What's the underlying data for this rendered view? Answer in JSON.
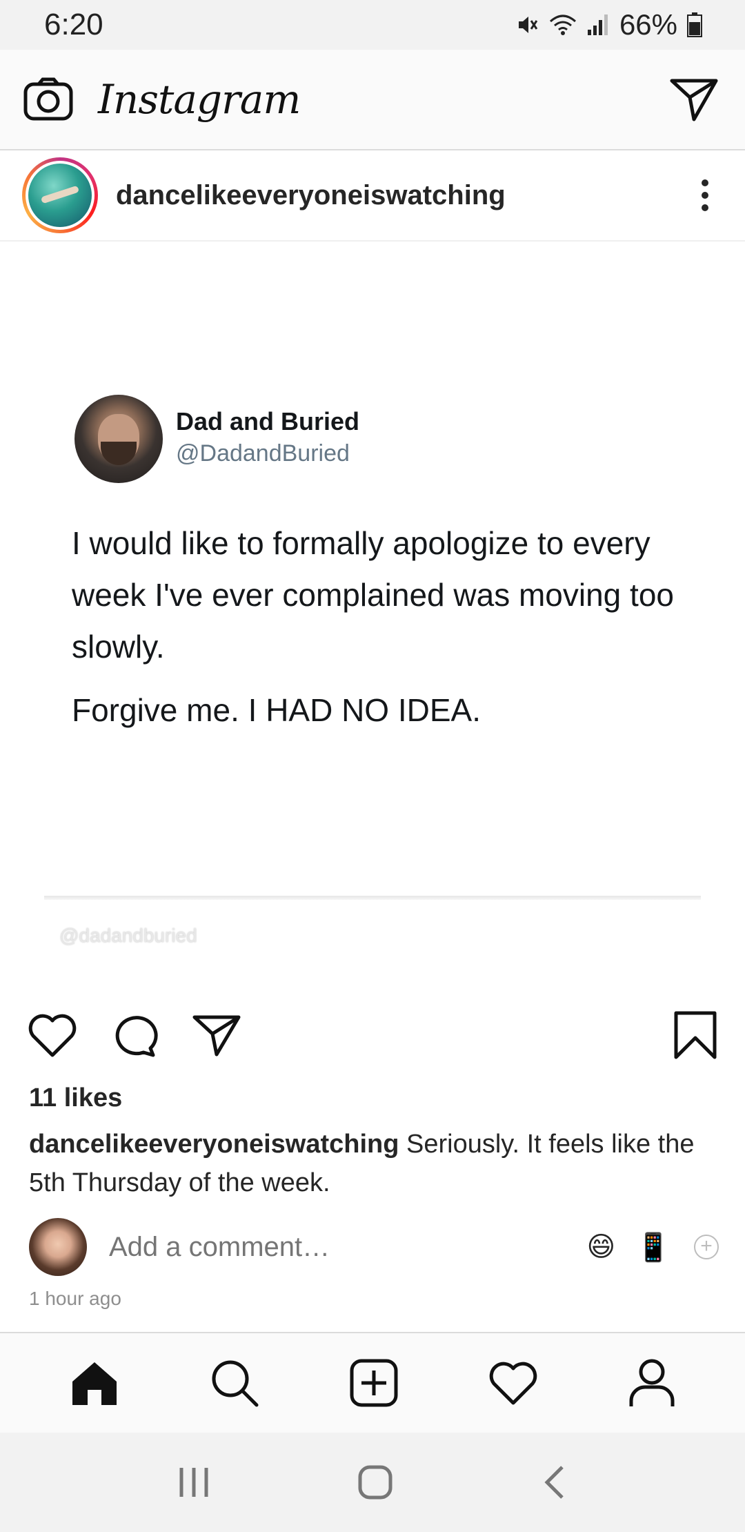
{
  "status_bar": {
    "time": "6:20",
    "battery": "66%",
    "icons": [
      "mute-icon",
      "wifi-icon",
      "signal-icon",
      "battery-icon"
    ]
  },
  "app_bar": {
    "logo_text": "Instagram",
    "camera_icon": "camera-icon",
    "direct_icon": "paper-plane-icon"
  },
  "post": {
    "username": "dancelikeeveryoneiswatching",
    "tweet": {
      "name": "Dad and Buried",
      "handle": "@DadandBuried",
      "text_1": "I would like to formally apologize to every week I've ever complained was moving too slowly.",
      "text_2": "Forgive me. I HAD NO IDEA.",
      "watermark": "@dadandburied"
    },
    "likes": "11 likes",
    "caption_user": "dancelikeeveryoneiswatching",
    "caption_text": " Seriously. It feels like the 5th Thursday of the week.",
    "comment_placeholder": "Add a comment…",
    "emoji_1": "😄",
    "emoji_2": "📱",
    "plus": "+",
    "timestamp": "1 hour ago"
  },
  "tab_bar": {
    "items": [
      "home-icon",
      "search-icon",
      "add-post-icon",
      "activity-heart-icon",
      "profile-icon"
    ]
  },
  "android_nav": {
    "items": [
      "recent-apps-icon",
      "home-button-icon",
      "back-icon"
    ]
  },
  "colors": {
    "text": "#262626",
    "secondary": "#8e8e8e",
    "tweet_handle": "#657786",
    "appbar_bg": "#fafafa"
  }
}
